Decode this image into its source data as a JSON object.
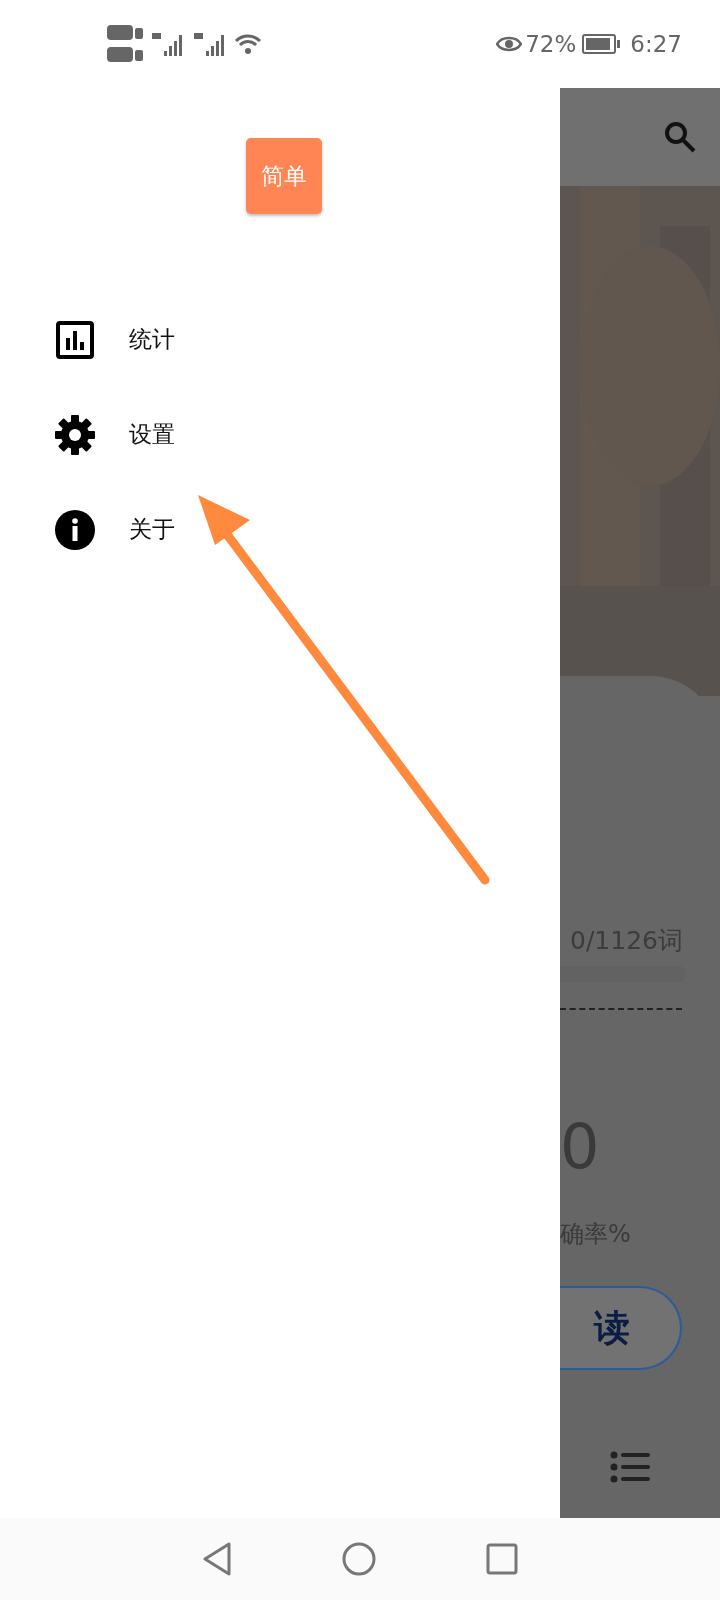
{
  "status_bar": {
    "battery": "72%",
    "time": "6:27"
  },
  "drawer": {
    "logo": "简单",
    "items": [
      {
        "kind": "stats",
        "label": "统计"
      },
      {
        "kind": "settings",
        "label": "设置"
      },
      {
        "kind": "info",
        "label": "关于"
      }
    ]
  },
  "background_app": {
    "progress_text": "0/1126词",
    "progress": {
      "level": 0
    },
    "score": "0",
    "score_label": "确率%",
    "read_button": "读"
  }
}
